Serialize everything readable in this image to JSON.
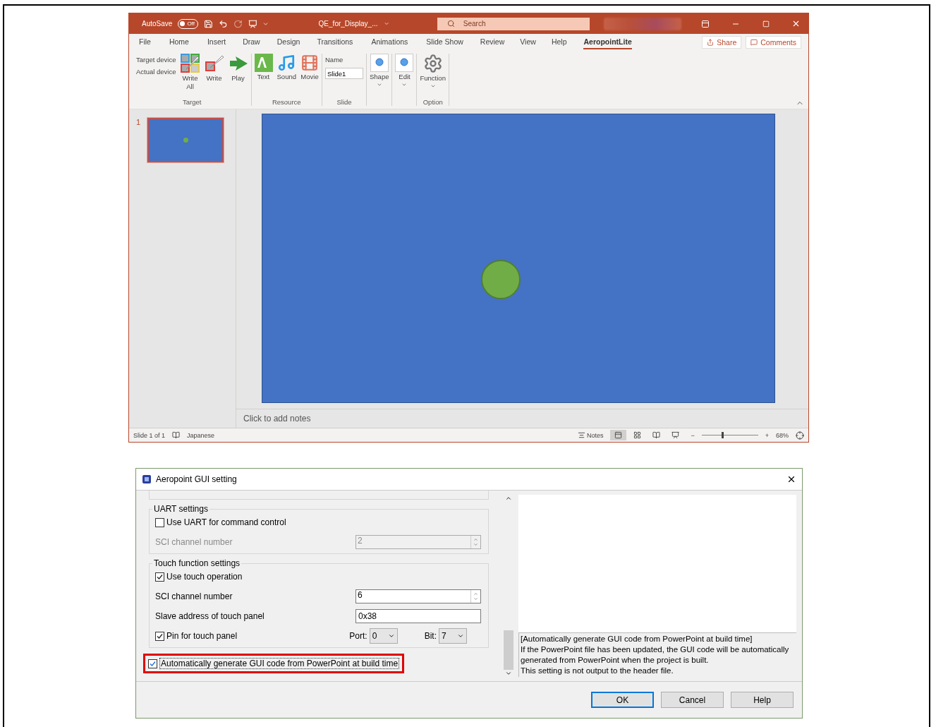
{
  "powerpoint": {
    "title_bar": {
      "autosave_label": "AutoSave",
      "autosave_state": "Off",
      "autosave_on": false,
      "file_name": "QE_for_Display_...",
      "search_placeholder": "Search"
    },
    "menu_tabs": [
      {
        "label": "File",
        "selected": false
      },
      {
        "label": "Home",
        "selected": false
      },
      {
        "label": "Insert",
        "selected": false
      },
      {
        "label": "Draw",
        "selected": false
      },
      {
        "label": "Design",
        "selected": false
      },
      {
        "label": "Transitions",
        "selected": false
      },
      {
        "label": "Animations",
        "selected": false
      },
      {
        "label": "Slide Show",
        "selected": false
      },
      {
        "label": "Review",
        "selected": false
      },
      {
        "label": "View",
        "selected": false
      },
      {
        "label": "Help",
        "selected": false
      },
      {
        "label": "AeropointLite",
        "selected": true
      }
    ],
    "share": "Share",
    "comments": "Comments",
    "ribbon_groups": [
      {
        "label": "Target",
        "items": [
          {
            "kind": "labels",
            "lines": [
              "Target device",
              "Actual device"
            ]
          },
          {
            "kind": "button",
            "label": "Write All",
            "dropdown": false
          },
          {
            "kind": "button",
            "label": "Write",
            "dropdown": false
          },
          {
            "kind": "button",
            "label": "Play",
            "dropdown": false
          }
        ]
      },
      {
        "label": "Resource",
        "items": [
          {
            "kind": "button",
            "label": "Text",
            "dropdown": false
          },
          {
            "kind": "button",
            "label": "Sound",
            "dropdown": false
          },
          {
            "kind": "button",
            "label": "Movie",
            "dropdown": false
          }
        ]
      },
      {
        "label": "Slide",
        "items": [
          {
            "kind": "field",
            "label": "Name",
            "value": "Slide1"
          }
        ]
      },
      {
        "items": [
          {
            "kind": "button",
            "label": "Shape",
            "dropdown": true
          }
        ]
      },
      {
        "items": [
          {
            "kind": "button",
            "label": "Edit",
            "dropdown": true
          }
        ]
      },
      {
        "label": "Option",
        "items": [
          {
            "kind": "button",
            "label": "Function",
            "dropdown": true
          }
        ]
      }
    ],
    "thumbnails": [
      {
        "number": "1",
        "selected": true
      }
    ],
    "notes_placeholder": "Click to add notes",
    "status_bar": {
      "slide_info": "Slide 1 of 1",
      "language": "Japanese",
      "notes": "Notes",
      "views": [
        {
          "selected": true
        },
        {
          "selected": false
        },
        {
          "selected": false
        },
        {
          "selected": false
        }
      ],
      "zoom_out": "−",
      "zoom_in": "+",
      "zoom_slider": {
        "level": 0.35
      },
      "zoom": "68%"
    }
  },
  "dialog": {
    "title": "Aeropoint GUI setting",
    "groups": [
      {
        "title": "UART settings",
        "rows": [
          {
            "kind": "checkbox",
            "label": "Use UART for command control",
            "checked": false
          },
          {
            "kind": "spinner",
            "label": "SCI channel number",
            "value": "2",
            "disabled": true
          }
        ]
      },
      {
        "title": "Touch function settings",
        "rows": [
          {
            "kind": "checkbox",
            "label": "Use touch operation",
            "checked": true
          },
          {
            "kind": "spinner",
            "label": "SCI channel number",
            "value": "6",
            "disabled": false
          },
          {
            "kind": "text",
            "label": "Slave address of touch panel",
            "value": "0x38",
            "disabled": false
          },
          {
            "kind": "pin",
            "label": "Pin for touch panel",
            "checked": true,
            "port_label": "Port:",
            "port": "0",
            "bit_label": "Bit:",
            "bit": "7"
          }
        ]
      }
    ],
    "auto_generate": {
      "label": "Automatically generate GUI code from PowerPoint at build time",
      "checked": true,
      "highlighted": true
    },
    "description": [
      "[Automatically generate GUI code from PowerPoint at build time]",
      "If the PowerPoint file has been updated, the GUI code will be automatically generated from PowerPoint when the project is built.",
      "This setting is not output to the header file."
    ],
    "buttons": [
      {
        "label": "OK",
        "default": true
      },
      {
        "label": "Cancel",
        "default": false
      },
      {
        "label": "Help",
        "default": false
      }
    ]
  }
}
